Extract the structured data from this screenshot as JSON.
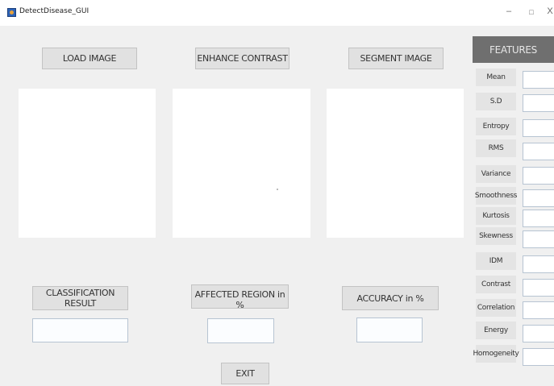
{
  "window": {
    "title": "DetectDisease_GUI",
    "minimize": "–",
    "maximize": "□",
    "close": "X"
  },
  "buttons": {
    "load_image": "LOAD IMAGE",
    "enhance_contrast": "ENHANCE CONTRAST",
    "segment_image": "SEGMENT IMAGE",
    "classification_result": "CLASSIFICATION RESULT",
    "affected_region": "AFFECTED REGION in %",
    "accuracy": "ACCURACY in %",
    "exit": "EXIT"
  },
  "features": {
    "header": "FEATURES",
    "items": [
      {
        "label": "Mean"
      },
      {
        "label": "S.D"
      },
      {
        "label": "Entropy"
      },
      {
        "label": "RMS"
      },
      {
        "label": "Variance"
      },
      {
        "label": "Smoothness"
      },
      {
        "label": "Kurtosis"
      },
      {
        "label": "Skewness"
      },
      {
        "label": "IDM"
      },
      {
        "label": "Contrast"
      },
      {
        "label": "Correlation"
      },
      {
        "label": "Energy"
      },
      {
        "label": "Homogeneity"
      }
    ]
  },
  "colors": {
    "background": "#f0f0f0",
    "features_header": "#6f6f6f",
    "button": "#e1e1e1"
  }
}
